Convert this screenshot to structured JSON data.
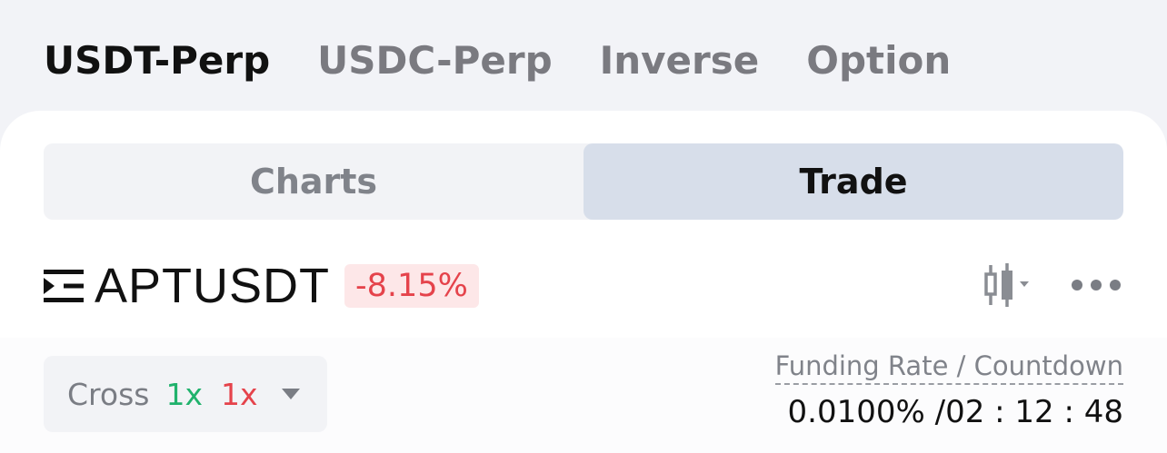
{
  "top_tabs": [
    {
      "label": "USDT-Perp",
      "active": true
    },
    {
      "label": "USDC-Perp",
      "active": false
    },
    {
      "label": "Inverse",
      "active": false
    },
    {
      "label": "Option",
      "active": false
    }
  ],
  "view_toggle": {
    "charts_label": "Charts",
    "trade_label": "Trade",
    "selected": "Trade"
  },
  "symbol": {
    "name": "APTUSDT",
    "change": "-8.15%"
  },
  "icons": {
    "menu": "menu-list-icon",
    "chart": "candlestick-chart-icon",
    "more": "more-dots-icon"
  },
  "margin": {
    "mode": "Cross",
    "long_leverage": "1x",
    "short_leverage": "1x"
  },
  "funding": {
    "label": "Funding Rate / Countdown",
    "value": "0.0100% /02 : 12 : 48"
  },
  "colors": {
    "positive": "#20b26c",
    "negative": "#e5434b",
    "active_segment": "#d7deea"
  }
}
